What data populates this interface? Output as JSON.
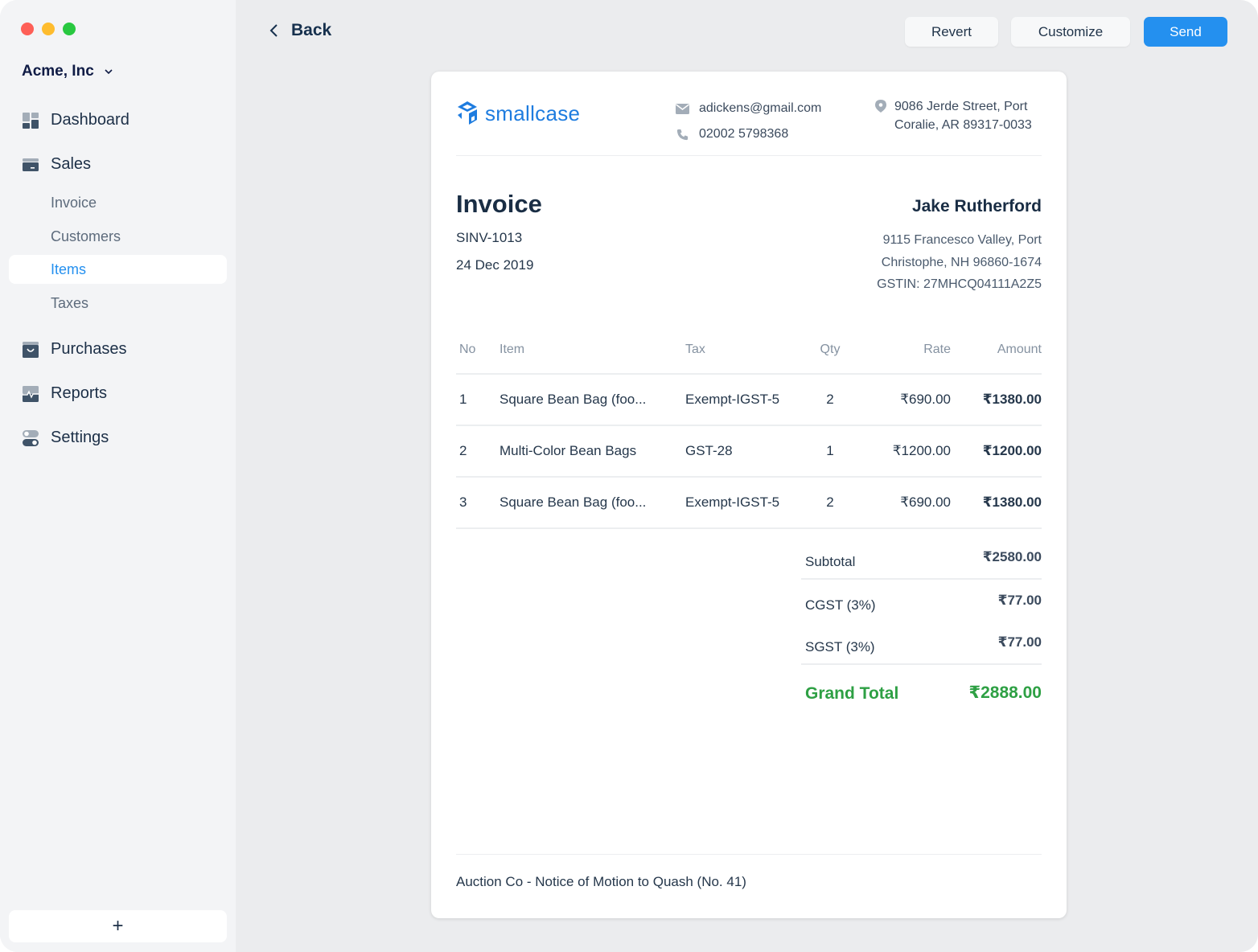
{
  "window": {
    "traffic_lights": [
      "close",
      "minimize",
      "maximize"
    ]
  },
  "sidebar": {
    "company": "Acme, Inc",
    "company_icon": "chevron-down-icon",
    "nav": [
      {
        "label": "Dashboard",
        "icon": "dashboard-icon"
      },
      {
        "label": "Sales",
        "icon": "sales-icon"
      },
      {
        "label": "Purchases",
        "icon": "purchases-icon"
      },
      {
        "label": "Reports",
        "icon": "reports-icon"
      },
      {
        "label": "Settings",
        "icon": "settings-icon"
      }
    ],
    "sales_sub": [
      {
        "label": "Invoice",
        "active": false
      },
      {
        "label": "Customers",
        "active": false
      },
      {
        "label": "Items",
        "active": true
      },
      {
        "label": "Taxes",
        "active": false
      }
    ],
    "add_label": "+"
  },
  "header": {
    "back_label": "Back",
    "buttons": {
      "revert": "Revert",
      "customize": "Customize",
      "send": "Send"
    }
  },
  "invoice": {
    "company_logo_text": "smallcase",
    "email": "adickens@gmail.com",
    "phone": "02002 5798368",
    "company_address": [
      "9086 Jerde Street, Port",
      "Coralie, AR 89317-0033"
    ],
    "title": "Invoice",
    "number": "SINV-1013",
    "date": "24 Dec 2019",
    "customer": {
      "name": "Jake Rutherford",
      "address": [
        "9115 Francesco Valley, Port",
        "Christophe, NH 96860-1674"
      ],
      "gstin": "GSTIN: 27MHCQ04111A2Z5"
    },
    "columns": [
      "No",
      "Item",
      "Tax",
      "Qty",
      "Rate",
      "Amount"
    ],
    "rows": [
      {
        "no": "1",
        "item": "Square Bean Bag (foo...",
        "tax": "Exempt-IGST-5",
        "qty": "2",
        "rate": "₹690.00",
        "amount": "₹1380.00"
      },
      {
        "no": "2",
        "item": "Multi-Color Bean Bags",
        "tax": "GST-28",
        "qty": "1",
        "rate": "₹1200.00",
        "amount": "₹1200.00"
      },
      {
        "no": "3",
        "item": "Square Bean Bag (foo...",
        "tax": "Exempt-IGST-5",
        "qty": "2",
        "rate": "₹690.00",
        "amount": "₹1380.00"
      }
    ],
    "totals": {
      "subtotal_label": "Subtotal",
      "subtotal": "₹2580.00",
      "cgst_label": "CGST (3%)",
      "cgst": "₹77.00",
      "sgst_label": "SGST (3%)",
      "sgst": "₹77.00",
      "grand_label": "Grand Total",
      "grand": "₹2888.00"
    },
    "footer_note": "Auction Co - Notice of Motion to Quash (No. 41)"
  },
  "colors": {
    "accent": "#2490ef",
    "brand": "#1e7cdf",
    "grand_total": "#2ea044"
  }
}
